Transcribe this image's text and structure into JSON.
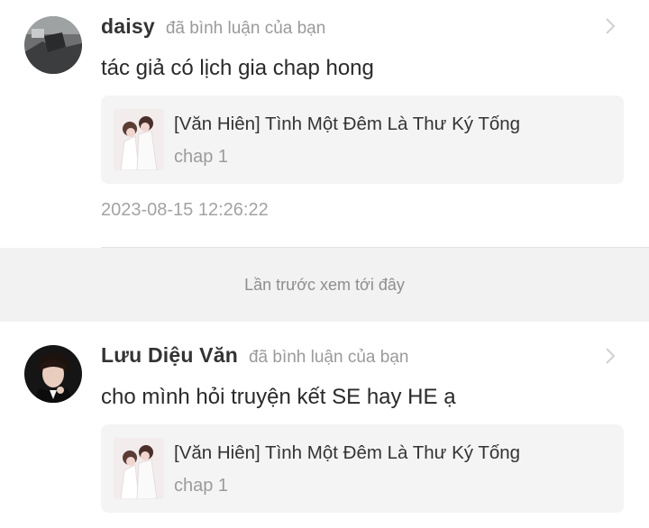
{
  "notifications": [
    {
      "username": "daisy",
      "action": "đã bình luận của bạn",
      "comment": "tác giả có lịch gia chap hong",
      "card": {
        "title": "[Văn Hiên] Tình Một Đêm Là Thư Ký Tống",
        "chapter": "chap 1"
      },
      "timestamp": "2023-08-15 12:26:22"
    },
    {
      "username": "Lưu Diệu Văn",
      "action": "đã bình luận của bạn",
      "comment": "cho mình hỏi truyện kết SE hay HE ạ",
      "card": {
        "title": "[Văn Hiên] Tình Một Đêm Là Thư Ký Tống",
        "chapter": "chap 1"
      }
    }
  ],
  "separator": {
    "label": "Lần trước xem tới đây"
  },
  "icons": {
    "chevron": "chevron-right-icon"
  }
}
